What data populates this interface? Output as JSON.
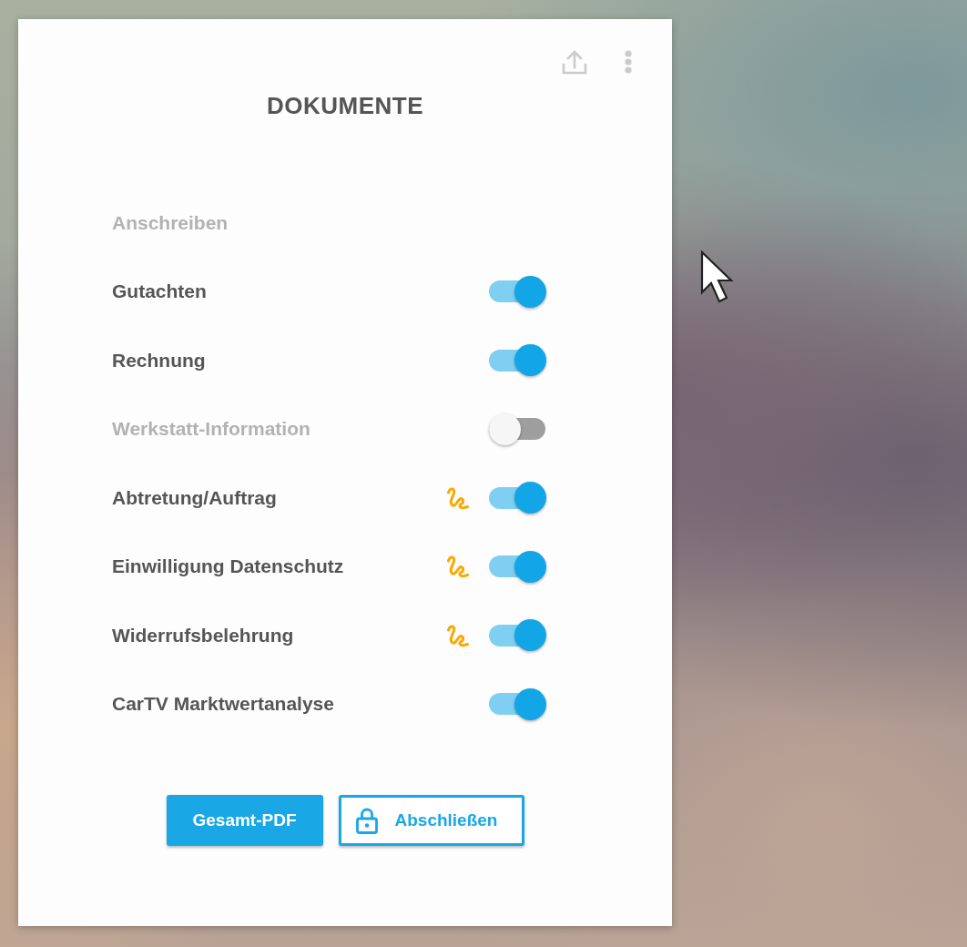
{
  "header": {
    "title": "DOKUMENTE"
  },
  "documents": [
    {
      "label": "Anschreiben",
      "kind": "plain",
      "on": false,
      "signature": false
    },
    {
      "label": "Gutachten",
      "kind": "toggle",
      "on": true,
      "signature": false
    },
    {
      "label": "Rechnung",
      "kind": "toggle",
      "on": true,
      "signature": false
    },
    {
      "label": "Werkstatt-Information",
      "kind": "toggle",
      "on": false,
      "signature": false
    },
    {
      "label": "Abtretung/Auftrag",
      "kind": "toggle",
      "on": true,
      "signature": true
    },
    {
      "label": "Einwilligung Datenschutz",
      "kind": "toggle",
      "on": true,
      "signature": true
    },
    {
      "label": "Widerrufsbelehrung",
      "kind": "toggle",
      "on": true,
      "signature": true
    },
    {
      "label": "CarTV Marktwertanalyse",
      "kind": "toggle",
      "on": true,
      "signature": false
    }
  ],
  "buttons": [
    {
      "label": "Gesamt-PDF",
      "kind": "primary"
    },
    {
      "label": "Abschließen",
      "kind": "lock"
    }
  ]
}
